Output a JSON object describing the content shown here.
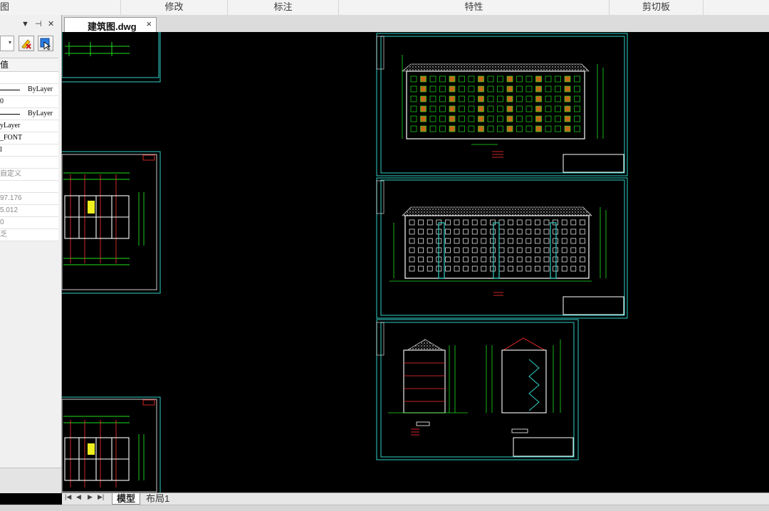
{
  "ribbon": {
    "groups": [
      "图",
      "修改",
      "标注",
      "特性",
      "剪切板"
    ]
  },
  "document_tab": {
    "title": "建筑图.dwg",
    "close": "×"
  },
  "panel": {
    "header_controls": [
      "▼",
      "⊣",
      "✕"
    ],
    "combo_arrow": "▾",
    "value_header": "值",
    "rows": [
      {
        "text": "",
        "kind": "blank"
      },
      {
        "text": "ByLayer",
        "kind": "line"
      },
      {
        "text": "0",
        "kind": "plain"
      },
      {
        "text": "ByLayer",
        "kind": "line"
      },
      {
        "text": "yLayer",
        "kind": "plain"
      },
      {
        "text": "_FONT",
        "kind": "plain"
      },
      {
        "text": "l",
        "kind": "plain"
      },
      {
        "text": "",
        "kind": "blank"
      },
      {
        "text": "自定义",
        "kind": "gray"
      },
      {
        "text": "",
        "kind": "blank"
      },
      {
        "text": "97.176",
        "kind": "gray"
      },
      {
        "text": "5.012",
        "kind": "gray"
      },
      {
        "text": "0",
        "kind": "gray"
      },
      {
        "text": "乏",
        "kind": "gray"
      }
    ]
  },
  "layout_tabs": {
    "nav": [
      "|◀",
      "◀",
      "▶",
      "▶|"
    ],
    "tabs": [
      "模型",
      "布局1"
    ],
    "active": "模型"
  },
  "colors": {
    "canvas": "#000000",
    "frame": "#2fd0c8",
    "wall": "#ffffff",
    "annot": "#1ee01e",
    "accent": "#ff3030"
  }
}
